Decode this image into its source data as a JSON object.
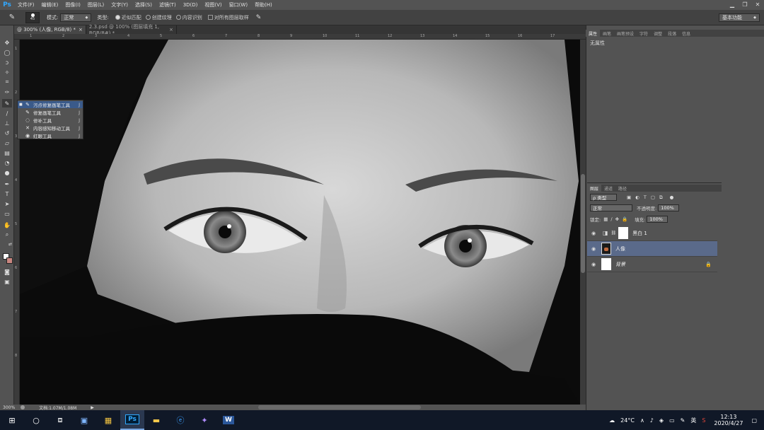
{
  "app": {
    "logo": "Ps"
  },
  "menu": [
    "文件(F)",
    "编辑(E)",
    "图像(I)",
    "图层(L)",
    "文字(Y)",
    "选择(S)",
    "滤镜(T)",
    "3D(D)",
    "视图(V)",
    "窗口(W)",
    "帮助(H)"
  ],
  "window_controls": {
    "minimize": "▁",
    "restore": "❐",
    "close": "✕"
  },
  "options": {
    "brush_size": "45",
    "mode_label": "模式:",
    "mode_value": "正常",
    "type_label": "类型:",
    "radio_1": "近似匹配",
    "radio_2": "创建纹理",
    "radio_3": "内容识别",
    "sample_all": "对所有图层取样",
    "workspace": "基本功能"
  },
  "tabs": [
    {
      "label": "@ 300% (人像, RGB/8) *",
      "close": "×"
    },
    {
      "label": "2.3.psd @ 100% (图层填充 1, RGB/8#) *",
      "close": "×"
    }
  ],
  "ruler_ticks": [
    "1",
    "2",
    "3",
    "4",
    "5",
    "6",
    "7",
    "8",
    "9",
    "10",
    "11",
    "12",
    "13",
    "14",
    "15",
    "16",
    "17"
  ],
  "vruler_ticks": [
    "1",
    "2",
    "3",
    "4",
    "5",
    "6",
    "7",
    "8"
  ],
  "flyout": [
    {
      "icon": "✎",
      "label": "污点修复画笔工具",
      "shortcut": "J"
    },
    {
      "icon": "✎",
      "label": "修复画笔工具",
      "shortcut": "J"
    },
    {
      "icon": "◌",
      "label": "修补工具",
      "shortcut": "J"
    },
    {
      "icon": "✕",
      "label": "内容感知移动工具",
      "shortcut": "J"
    },
    {
      "icon": "◉",
      "label": "红眼工具",
      "shortcut": "J"
    }
  ],
  "status": {
    "zoom": "300%",
    "doc": "文档:1.07M/1.08M",
    "arrow": "▶"
  },
  "properties": {
    "tabs": [
      "属性",
      "画笔",
      "画笔预设",
      "字符",
      "调整",
      "段落",
      "信息"
    ],
    "empty_text": "无属性"
  },
  "layers": {
    "tabs": [
      "图层",
      "通道",
      "路径"
    ],
    "filter_label": "ρ 类型",
    "blend_mode": "正常",
    "opacity_label": "不透明度:",
    "opacity_value": "100%",
    "lock_label": "锁定:",
    "fill_label": "填充:",
    "fill_value": "100%",
    "items": [
      {
        "name": "黑白 1",
        "selected": false
      },
      {
        "name": "人像",
        "selected": true
      },
      {
        "name": "背景",
        "selected": false
      }
    ]
  },
  "taskbar": {
    "temperature": "24°C",
    "ime": "英",
    "time": "12:13",
    "date": "2020/4/27",
    "ps_label": "Ps",
    "word_label": "W"
  }
}
